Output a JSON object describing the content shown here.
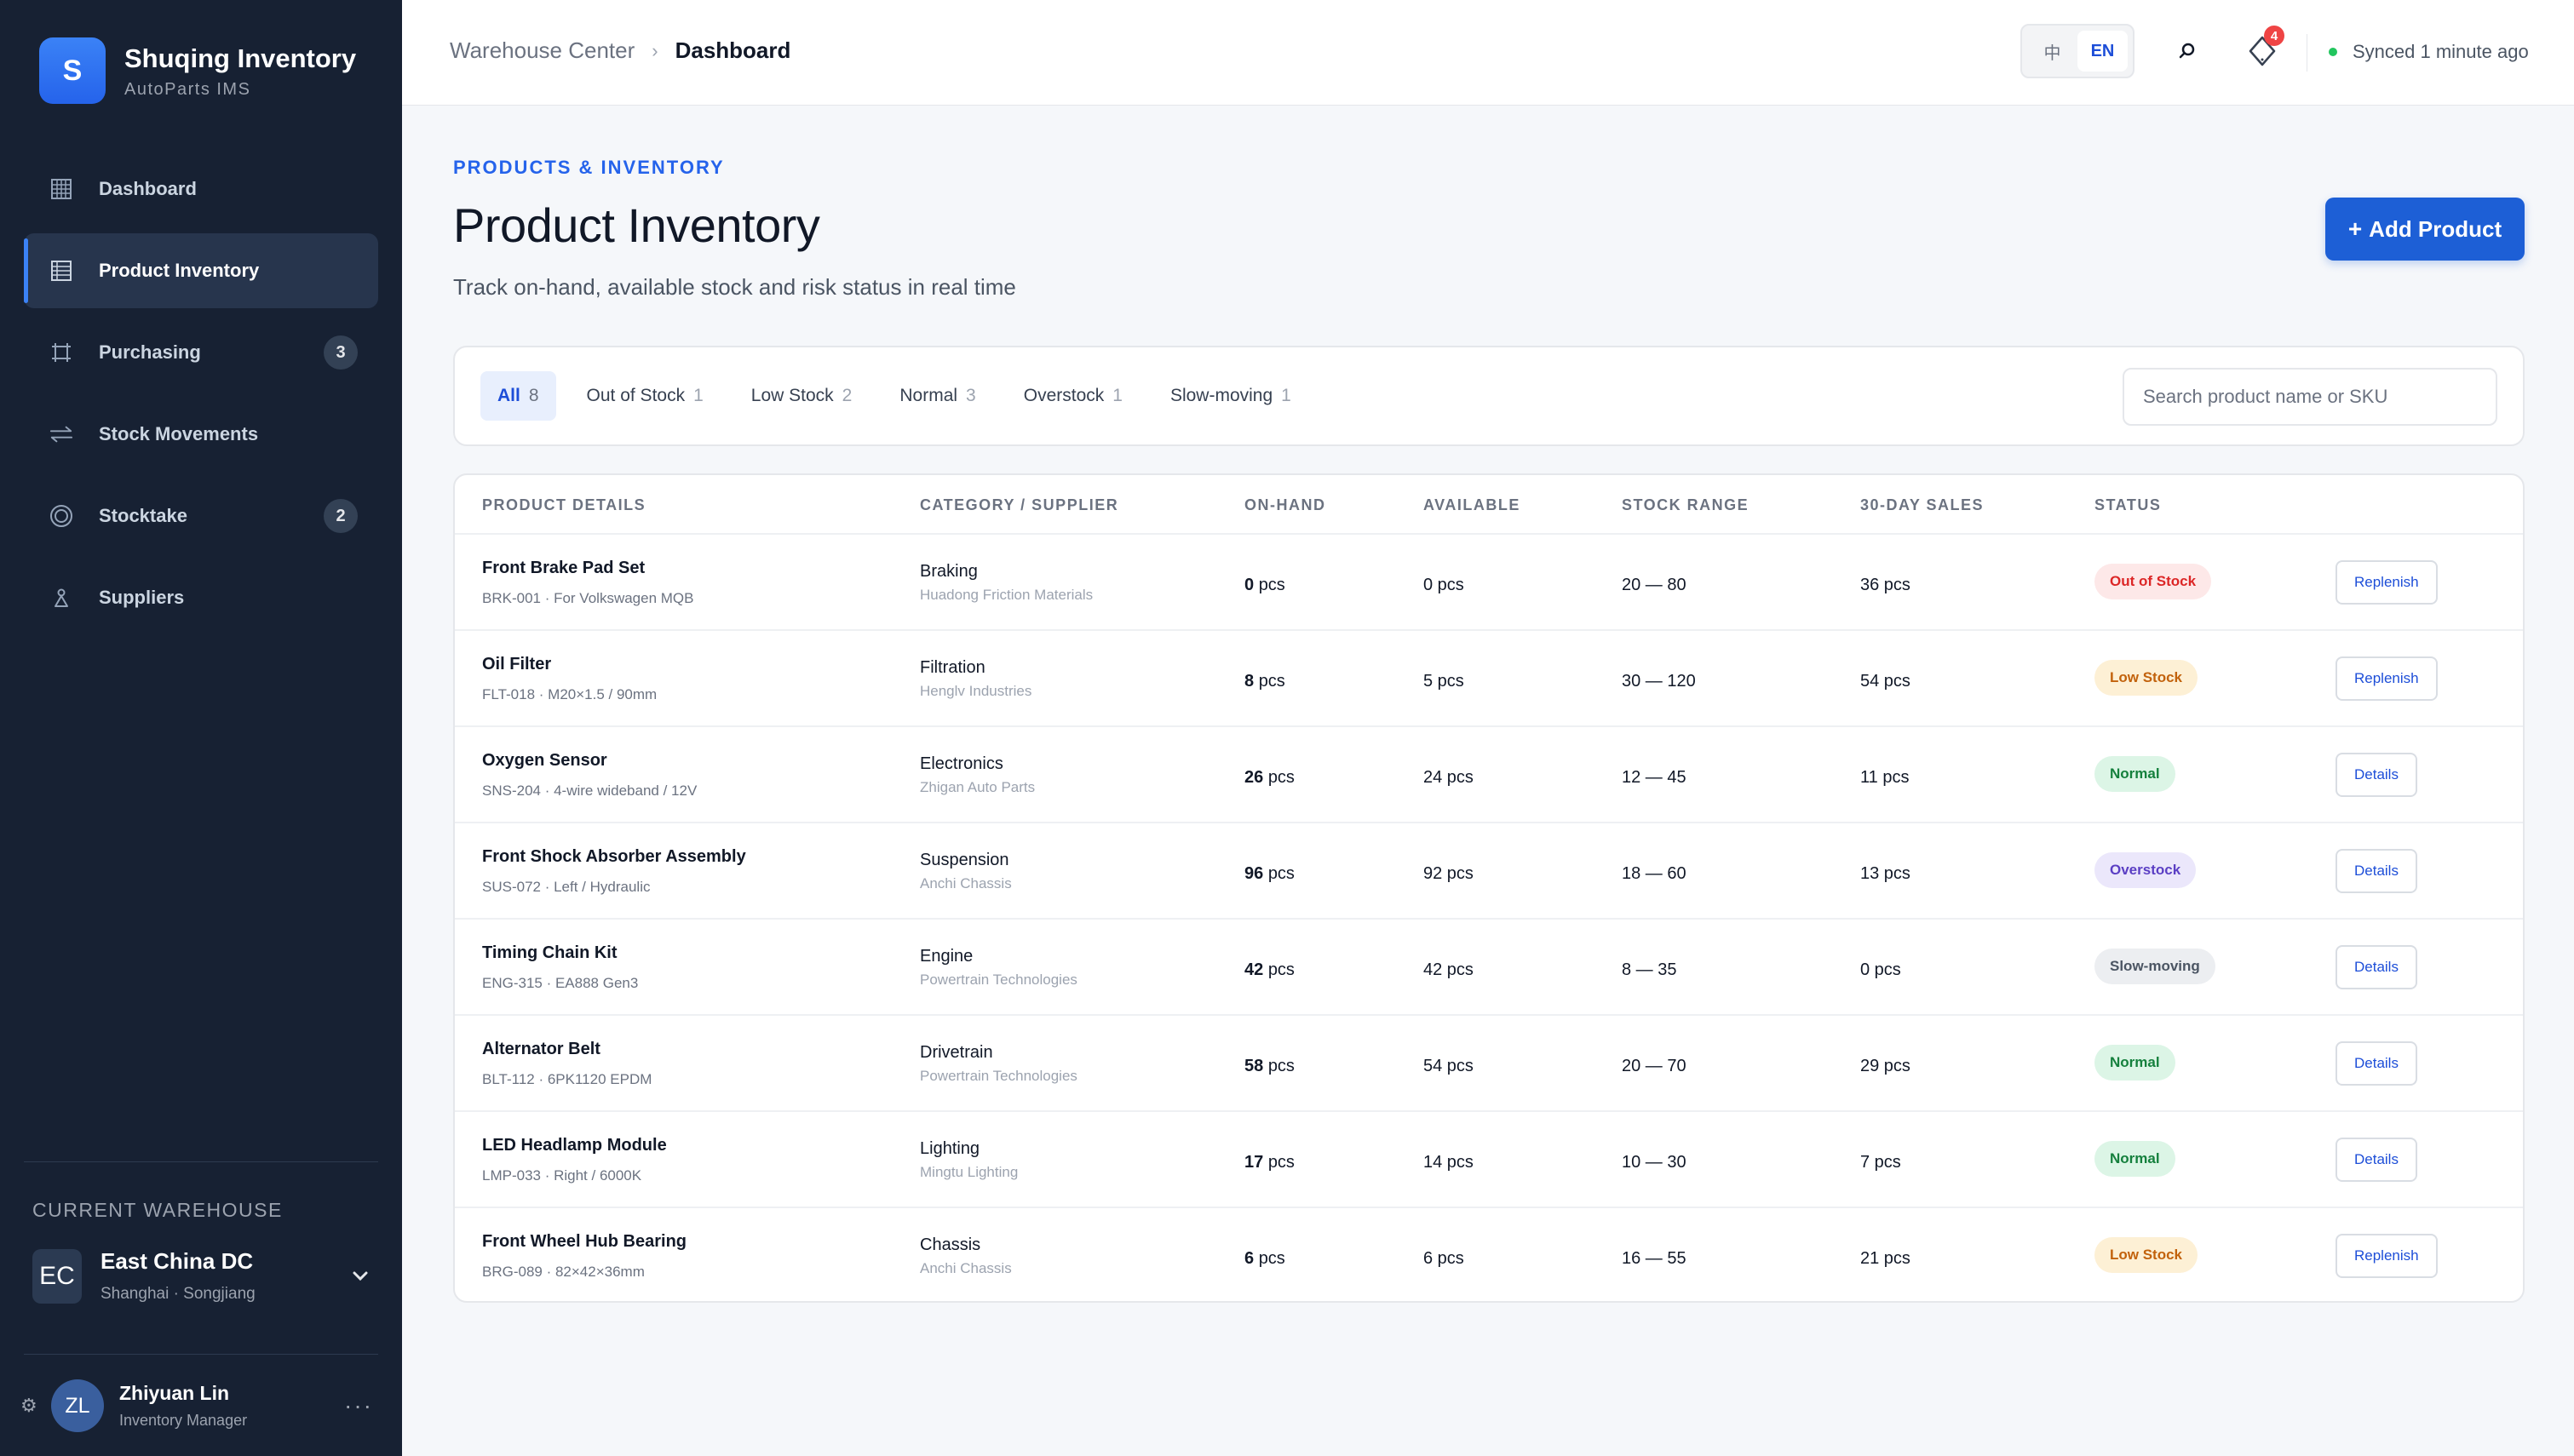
{
  "brand": {
    "logo_letter": "S",
    "name": "Shuqing Inventory",
    "subtitle": "AutoParts IMS",
    "color": "#2563eb"
  },
  "nav": [
    {
      "id": "dashboard",
      "label": "Dashboard",
      "icon": "grid-icon",
      "active": false,
      "badge": null
    },
    {
      "id": "product-inventory",
      "label": "Product Inventory",
      "icon": "list-icon",
      "active": true,
      "badge": null
    },
    {
      "id": "purchasing",
      "label": "Purchasing",
      "icon": "frame-icon",
      "active": false,
      "badge": "3"
    },
    {
      "id": "stock-movements",
      "label": "Stock Movements",
      "icon": "arrows-icon",
      "active": false,
      "badge": null
    },
    {
      "id": "stocktake",
      "label": "Stocktake",
      "icon": "target-icon",
      "active": false,
      "badge": "2"
    },
    {
      "id": "suppliers",
      "label": "Suppliers",
      "icon": "person-icon",
      "active": false,
      "badge": null
    }
  ],
  "warehouse": {
    "section_title": "CURRENT WAREHOUSE",
    "initials": "EC",
    "name": "East China DC",
    "location": "Shanghai · Songjiang"
  },
  "user": {
    "initials": "ZL",
    "name": "Zhiyuan Lin",
    "role": "Inventory Manager"
  },
  "topbar": {
    "breadcrumb_parent": "Warehouse Center",
    "breadcrumb_current": "Dashboard",
    "lang_zh": "中",
    "lang_en": "EN",
    "notification_count": "4",
    "sync_status": "Synced 1 minute ago"
  },
  "page": {
    "eyebrow": "PRODUCTS & INVENTORY",
    "title": "Product Inventory",
    "subtitle": "Track on-hand, available stock and risk status in real time",
    "add_button": "Add Product"
  },
  "filters": [
    {
      "label": "All",
      "count": "8",
      "active": true
    },
    {
      "label": "Out of Stock",
      "count": "1",
      "active": false
    },
    {
      "label": "Low Stock",
      "count": "2",
      "active": false
    },
    {
      "label": "Normal",
      "count": "3",
      "active": false
    },
    {
      "label": "Overstock",
      "count": "1",
      "active": false
    },
    {
      "label": "Slow-moving",
      "count": "1",
      "active": false
    }
  ],
  "search": {
    "placeholder": "Search product name or SKU"
  },
  "table": {
    "columns": [
      "PRODUCT DETAILS",
      "CATEGORY / SUPPLIER",
      "ON-HAND",
      "AVAILABLE",
      "STOCK RANGE",
      "30-DAY SALES",
      "STATUS"
    ],
    "unit": "pcs",
    "rows": [
      {
        "name": "Front Brake Pad Set",
        "meta": "BRK-001 · For Volkswagen MQB",
        "category": "Braking",
        "supplier": "Huadong Friction Materials",
        "on_hand": "0",
        "available": "0 pcs",
        "range": "20 — 80",
        "sales": "36 pcs",
        "status": "Out of Stock",
        "status_key": "out",
        "action": "Replenish"
      },
      {
        "name": "Oil Filter",
        "meta": "FLT-018 · M20×1.5 / 90mm",
        "category": "Filtration",
        "supplier": "Henglv Industries",
        "on_hand": "8",
        "available": "5 pcs",
        "range": "30 — 120",
        "sales": "54 pcs",
        "status": "Low Stock",
        "status_key": "low",
        "action": "Replenish"
      },
      {
        "name": "Oxygen Sensor",
        "meta": "SNS-204 · 4-wire wideband / 12V",
        "category": "Electronics",
        "supplier": "Zhigan Auto Parts",
        "on_hand": "26",
        "available": "24 pcs",
        "range": "12 — 45",
        "sales": "11 pcs",
        "status": "Normal",
        "status_key": "normal",
        "action": "Details"
      },
      {
        "name": "Front Shock Absorber Assembly",
        "meta": "SUS-072 · Left / Hydraulic",
        "category": "Suspension",
        "supplier": "Anchi Chassis",
        "on_hand": "96",
        "available": "92 pcs",
        "range": "18 — 60",
        "sales": "13 pcs",
        "status": "Overstock",
        "status_key": "over",
        "action": "Details"
      },
      {
        "name": "Timing Chain Kit",
        "meta": "ENG-315 · EA888 Gen3",
        "category": "Engine",
        "supplier": "Powertrain Technologies",
        "on_hand": "42",
        "available": "42 pcs",
        "range": "8 — 35",
        "sales": "0 pcs",
        "status": "Slow-moving",
        "status_key": "slow",
        "action": "Details"
      },
      {
        "name": "Alternator Belt",
        "meta": "BLT-112 · 6PK1120 EPDM",
        "category": "Drivetrain",
        "supplier": "Powertrain Technologies",
        "on_hand": "58",
        "available": "54 pcs",
        "range": "20 — 70",
        "sales": "29 pcs",
        "status": "Normal",
        "status_key": "normal",
        "action": "Details"
      },
      {
        "name": "LED Headlamp Module",
        "meta": "LMP-033 · Right / 6000K",
        "category": "Lighting",
        "supplier": "Mingtu Lighting",
        "on_hand": "17",
        "available": "14 pcs",
        "range": "10 — 30",
        "sales": "7 pcs",
        "status": "Normal",
        "status_key": "normal",
        "action": "Details"
      },
      {
        "name": "Front Wheel Hub Bearing",
        "meta": "BRG-089 · 82×42×36mm",
        "category": "Chassis",
        "supplier": "Anchi Chassis",
        "on_hand": "6",
        "available": "6 pcs",
        "range": "16 — 55",
        "sales": "21 pcs",
        "status": "Low Stock",
        "status_key": "low",
        "action": "Replenish"
      }
    ]
  }
}
